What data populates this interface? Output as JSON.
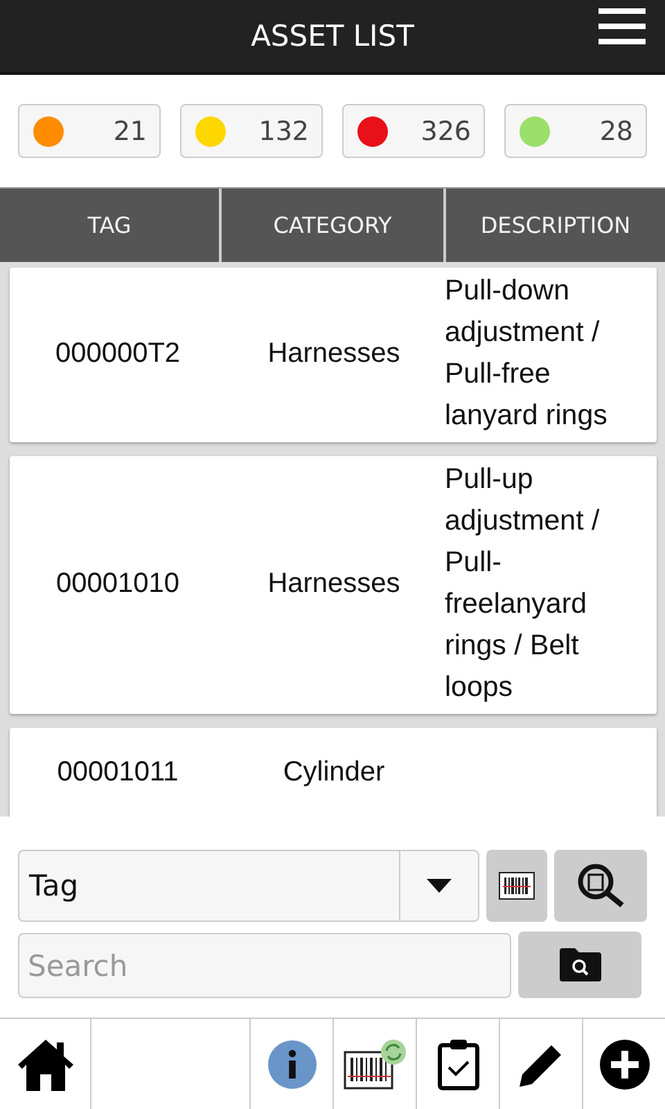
{
  "header": {
    "title": "ASSET LIST"
  },
  "counters": [
    {
      "color": "#ff8c00",
      "count": "21"
    },
    {
      "color": "#ffd700",
      "count": "132"
    },
    {
      "color": "#e8111a",
      "count": "326"
    },
    {
      "color": "#9be06a",
      "count": "28"
    }
  ],
  "table": {
    "columns": [
      "TAG",
      "CATEGORY",
      "DESCRIPTION"
    ],
    "rows": [
      {
        "tag": "000000T2",
        "category": "Harnesses",
        "description": "Pull-down adjustment / Pull-free lanyard rings"
      },
      {
        "tag": "00001010",
        "category": "Harnesses",
        "description": "Pull-up adjustment / Pull-freelanyard rings / Belt loops"
      },
      {
        "tag": "00001011",
        "category": "Cylinder",
        "description": ""
      }
    ]
  },
  "filter": {
    "field": "Tag"
  },
  "search": {
    "placeholder": "Search"
  }
}
